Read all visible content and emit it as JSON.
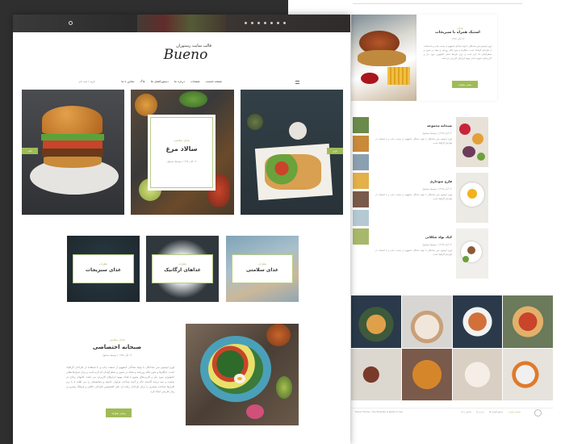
{
  "brand": {
    "tagline": "قالب سایت رستوران",
    "logo": "Bueno"
  },
  "topbar": {
    "social_icons": [
      "pinterest-icon",
      "facebook-icon",
      "twitter-icon",
      "vimeo-icon",
      "youtube-icon",
      "instagram-icon",
      "google-plus-icon",
      "linkedin-icon"
    ]
  },
  "nav": {
    "items": [
      "صفحه نخست",
      "صفحات",
      "درباره ما",
      "دستورالعمل ها",
      "بلاگ",
      "تماس با ما"
    ],
    "right": "خرید / ثبت نام"
  },
  "hero": {
    "category": "غذای سلامتی",
    "title": "سالاد مرغ",
    "meta": "۱۲ آبان ۱۳۹۸ | توسط مسئول",
    "left_tag": "خانه",
    "right_tag": "بازی"
  },
  "categories": [
    {
      "tag": "نظرات",
      "label": "غذای سبزیجات"
    },
    {
      "tag": "نظرات",
      "label": "غذاهای ارگانیک"
    },
    {
      "tag": "نظرات",
      "label": "غذای سلامتی"
    }
  ],
  "featured": {
    "category": "غذای سلامتی",
    "title": "صبحانه اختصاصی",
    "meta": "۱۲ آبان ۱۳۹۸ | توسط مسئول",
    "paragraph": "لورم ایپسوم متن ساختگی با تولید سادگی نامفهوم از صنعت چاپ و با استفاده از طراحان گرافیک است. چاپگرها و متون بلکه روزنامه و مجله در ستون و سطرآنچنان که لازم است و برای شرایط فعلی تکنولوژی مورد نیاز و کاربردهای متنوع با هدف بهبود ابزارهای کاربردی می باشد. کتابهای زیادی در شصت و سه درصد گذشته حال و آینده شناخت فراوان جامعه و متخصصان را می طلبد تا با نرم افزارها شناخت بیشتری را برای طراحان رایانه ای علی الخصوص طراحان خلاقی و فرهنگ پیشرو در زبان فارسی ایجاد کرد.",
    "button": "بیشتر بخوانید"
  },
  "right_top": {
    "category": "غذای",
    "title": "استیک همراه با سبزیجات",
    "meta": "۱۲ آبان ۱۳۹۸",
    "paragraph": "لورم ایپسوم متن ساختگی با تولید سادگی نامفهوم از صنعت چاپ و با استفاده از طراحان گرافیک است. چاپگرها و متون بلکه روزنامه و مجله در ستون و سطرآنچنان که لازم است و برای شرایط فعلی تکنولوژی مورد نیاز و کاربردهای متنوع با هدف بهبود ابزارهای کاربردی می باشد.",
    "button": "بیشتر بخوانید"
  },
  "right_posts": [
    {
      "title": "صبحانه مجموعه",
      "meta": "۱۲ آبان ۱۳۹۸ | توسط مسئول",
      "paragraph": "لورم ایپسوم متن ساختگی با تولید سادگی نامفهوم از صنعت چاپ و با استفاده از طراحان گرافیک است."
    },
    {
      "title": "فارچ سوخاری",
      "meta": "۱۲ آبان ۱۳۹۸ | توسط مسئول",
      "paragraph": "لورم ایپسوم متن ساختگی با تولید سادگی نامفهوم از صنعت چاپ و با استفاده از طراحان گرافیک است."
    },
    {
      "title": "کیک تولد شکلاتی",
      "meta": "۱۲ آبان ۱۳۹۸ | توسط مسئول",
      "paragraph": "لورم ایپسوم متن ساختگی با تولید سادگی نامفهوم از صنعت چاپ و با استفاده از طراحان گرافیک است."
    }
  ],
  "footer": {
    "links": [
      "صفحه نخست",
      "دستورالعمل ها",
      "درباره ما",
      "تماس با ما"
    ],
    "copyright": "Bueno Theme - The Template is Ready to Use"
  },
  "colors": {
    "accent": "#9fbb57",
    "dark_bg": "#2f2f30"
  }
}
